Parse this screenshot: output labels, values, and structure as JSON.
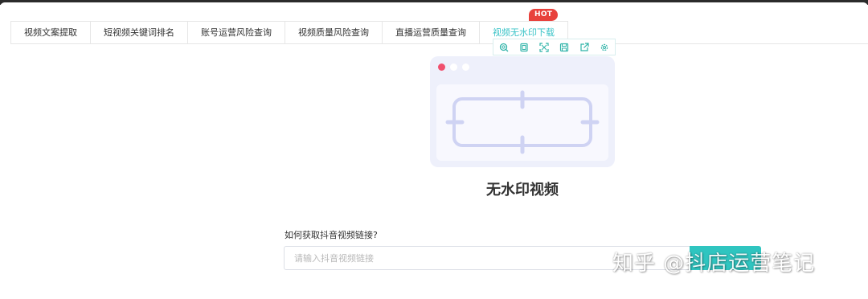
{
  "tabs": [
    {
      "label": "视频文案提取",
      "active": false
    },
    {
      "label": "短视频关键词排名",
      "active": false
    },
    {
      "label": "账号运营风险查询",
      "active": false
    },
    {
      "label": "视频质量风险查询",
      "active": false
    },
    {
      "label": "直播运营质量查询",
      "active": false
    },
    {
      "label": "视频无水印下载",
      "active": true
    }
  ],
  "hot_badge": "HOT",
  "toolbar": {
    "icons": [
      "search-icon",
      "copy-icon",
      "fullscreen-icon",
      "save-icon",
      "share-icon",
      "settings-icon"
    ]
  },
  "illustration": {
    "dot_colors": [
      "#f0506e",
      "#ffffff",
      "#ffffff"
    ],
    "frame_color": "#cfd3f3"
  },
  "main": {
    "title": "无水印视频",
    "question": "如何获取抖音视频链接?",
    "input_placeholder": "请输入抖音视频链接",
    "input_value": "",
    "submit_label": ""
  },
  "watermark": "知乎 @抖店运营笔记",
  "colors": {
    "accent": "#38c3c7",
    "button": "#2fc5c0",
    "hot": "#e8413c"
  }
}
